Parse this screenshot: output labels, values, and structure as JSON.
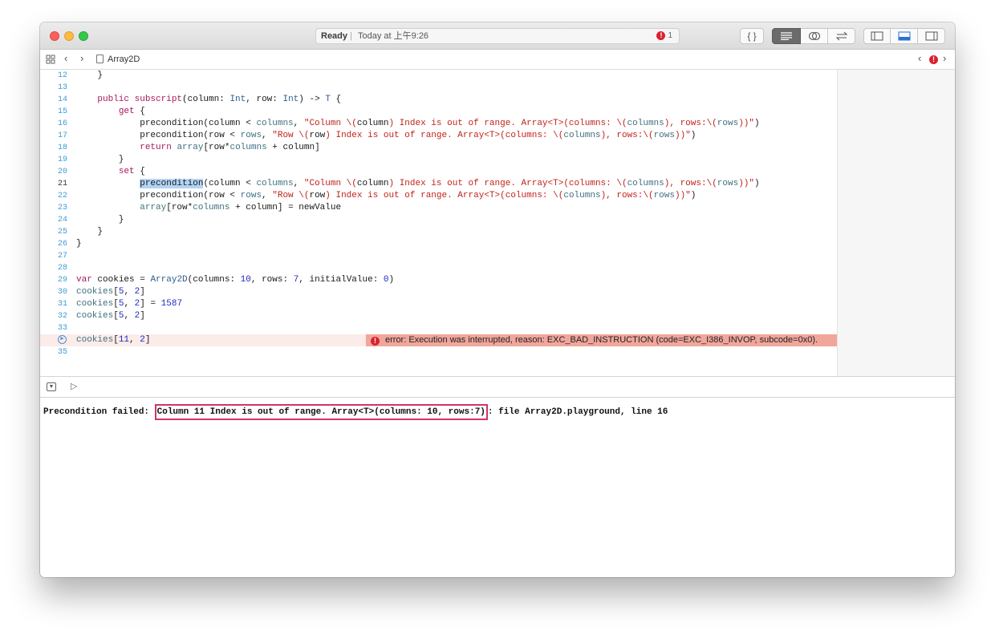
{
  "window": {
    "status": {
      "state": "Ready",
      "separator": "|",
      "time": "Today at 上午9:26",
      "error_count": "1"
    },
    "toolbar": {
      "code_braces": "{ }"
    }
  },
  "jumpbar": {
    "file_name": "Array2D",
    "issue_count": "!"
  },
  "editor": {
    "lines": [
      {
        "n": "12",
        "segments": [
          {
            "t": "    }",
            "c": ""
          }
        ]
      },
      {
        "n": "13",
        "segments": []
      },
      {
        "n": "14",
        "segments": [
          {
            "t": "    ",
            "c": ""
          },
          {
            "t": "public subscript",
            "c": "kw"
          },
          {
            "t": "(column: ",
            "c": ""
          },
          {
            "t": "Int",
            "c": "ty"
          },
          {
            "t": ", row: ",
            "c": ""
          },
          {
            "t": "Int",
            "c": "ty"
          },
          {
            "t": ") -> ",
            "c": ""
          },
          {
            "t": "T",
            "c": "ty"
          },
          {
            "t": " {",
            "c": ""
          }
        ]
      },
      {
        "n": "15",
        "segments": [
          {
            "t": "        ",
            "c": ""
          },
          {
            "t": "get",
            "c": "kw"
          },
          {
            "t": " {",
            "c": ""
          }
        ]
      },
      {
        "n": "16",
        "segments": [
          {
            "t": "            precondition(column < ",
            "c": ""
          },
          {
            "t": "columns",
            "c": "prop"
          },
          {
            "t": ", ",
            "c": ""
          },
          {
            "t": "\"Column \\(",
            "c": "str"
          },
          {
            "t": "column",
            "c": ""
          },
          {
            "t": ") Index is out of range. Array<T>(columns: \\(",
            "c": "str"
          },
          {
            "t": "columns",
            "c": "prop"
          },
          {
            "t": "), rows:\\(",
            "c": "str"
          },
          {
            "t": "rows",
            "c": "prop"
          },
          {
            "t": "))\"",
            "c": "str"
          },
          {
            "t": ")",
            "c": ""
          }
        ]
      },
      {
        "n": "17",
        "segments": [
          {
            "t": "            precondition(row < ",
            "c": ""
          },
          {
            "t": "rows",
            "c": "prop"
          },
          {
            "t": ", ",
            "c": ""
          },
          {
            "t": "\"Row \\(",
            "c": "str"
          },
          {
            "t": "row",
            "c": ""
          },
          {
            "t": ") Index is out of range. Array<T>(columns: \\(",
            "c": "str"
          },
          {
            "t": "columns",
            "c": "prop"
          },
          {
            "t": "), rows:\\(",
            "c": "str"
          },
          {
            "t": "rows",
            "c": "prop"
          },
          {
            "t": "))\"",
            "c": "str"
          },
          {
            "t": ")",
            "c": ""
          }
        ]
      },
      {
        "n": "18",
        "segments": [
          {
            "t": "            ",
            "c": ""
          },
          {
            "t": "return",
            "c": "kw"
          },
          {
            "t": " ",
            "c": ""
          },
          {
            "t": "array",
            "c": "prop"
          },
          {
            "t": "[row*",
            "c": ""
          },
          {
            "t": "columns",
            "c": "prop"
          },
          {
            "t": " + column]",
            "c": ""
          }
        ]
      },
      {
        "n": "19",
        "segments": [
          {
            "t": "        }",
            "c": ""
          }
        ]
      },
      {
        "n": "20",
        "segments": [
          {
            "t": "        ",
            "c": ""
          },
          {
            "t": "set",
            "c": "kw"
          },
          {
            "t": " {",
            "c": ""
          }
        ]
      },
      {
        "n": "21",
        "current": true,
        "segments": [
          {
            "t": "            ",
            "c": ""
          },
          {
            "t": "precondition",
            "c": "sel"
          },
          {
            "t": "(column < ",
            "c": ""
          },
          {
            "t": "columns",
            "c": "prop"
          },
          {
            "t": ", ",
            "c": ""
          },
          {
            "t": "\"Column \\(",
            "c": "str"
          },
          {
            "t": "column",
            "c": ""
          },
          {
            "t": ") Index is out of range. Array<T>(columns: \\(",
            "c": "str"
          },
          {
            "t": "columns",
            "c": "prop"
          },
          {
            "t": "), rows:\\(",
            "c": "str"
          },
          {
            "t": "rows",
            "c": "prop"
          },
          {
            "t": "))\"",
            "c": "str"
          },
          {
            "t": ")",
            "c": ""
          }
        ]
      },
      {
        "n": "22",
        "segments": [
          {
            "t": "            precondition(row < ",
            "c": ""
          },
          {
            "t": "rows",
            "c": "prop"
          },
          {
            "t": ", ",
            "c": ""
          },
          {
            "t": "\"Row \\(",
            "c": "str"
          },
          {
            "t": "row",
            "c": ""
          },
          {
            "t": ") Index is out of range. Array<T>(columns: \\(",
            "c": "str"
          },
          {
            "t": "columns",
            "c": "prop"
          },
          {
            "t": "), rows:\\(",
            "c": "str"
          },
          {
            "t": "rows",
            "c": "prop"
          },
          {
            "t": "))\"",
            "c": "str"
          },
          {
            "t": ")",
            "c": ""
          }
        ]
      },
      {
        "n": "23",
        "segments": [
          {
            "t": "            ",
            "c": ""
          },
          {
            "t": "array",
            "c": "prop"
          },
          {
            "t": "[row*",
            "c": ""
          },
          {
            "t": "columns",
            "c": "prop"
          },
          {
            "t": " + column] = newValue",
            "c": ""
          }
        ]
      },
      {
        "n": "24",
        "segments": [
          {
            "t": "        }",
            "c": ""
          }
        ]
      },
      {
        "n": "25",
        "segments": [
          {
            "t": "    }",
            "c": ""
          }
        ]
      },
      {
        "n": "26",
        "segments": [
          {
            "t": "}",
            "c": ""
          }
        ]
      },
      {
        "n": "27",
        "segments": []
      },
      {
        "n": "28",
        "segments": []
      },
      {
        "n": "29",
        "segments": [
          {
            "t": "var",
            "c": "kw"
          },
          {
            "t": " cookies = ",
            "c": ""
          },
          {
            "t": "Array2D",
            "c": "ty"
          },
          {
            "t": "(columns: ",
            "c": ""
          },
          {
            "t": "10",
            "c": "num"
          },
          {
            "t": ", rows: ",
            "c": ""
          },
          {
            "t": "7",
            "c": "num"
          },
          {
            "t": ", initialValue: ",
            "c": ""
          },
          {
            "t": "0",
            "c": "num"
          },
          {
            "t": ")",
            "c": ""
          }
        ]
      },
      {
        "n": "30",
        "segments": [
          {
            "t": "cookies",
            "c": "prop"
          },
          {
            "t": "[",
            "c": ""
          },
          {
            "t": "5",
            "c": "num"
          },
          {
            "t": ", ",
            "c": ""
          },
          {
            "t": "2",
            "c": "num"
          },
          {
            "t": "]",
            "c": ""
          }
        ]
      },
      {
        "n": "31",
        "segments": [
          {
            "t": "cookies",
            "c": "prop"
          },
          {
            "t": "[",
            "c": ""
          },
          {
            "t": "5",
            "c": "num"
          },
          {
            "t": ", ",
            "c": ""
          },
          {
            "t": "2",
            "c": "num"
          },
          {
            "t": "] = ",
            "c": ""
          },
          {
            "t": "1587",
            "c": "num"
          }
        ]
      },
      {
        "n": "32",
        "segments": [
          {
            "t": "cookies",
            "c": "prop"
          },
          {
            "t": "[",
            "c": ""
          },
          {
            "t": "5",
            "c": "num"
          },
          {
            "t": ", ",
            "c": ""
          },
          {
            "t": "2",
            "c": "num"
          },
          {
            "t": "]",
            "c": ""
          }
        ]
      },
      {
        "n": "33",
        "segments": []
      },
      {
        "n": "",
        "error": true,
        "segments": [
          {
            "t": "cookies",
            "c": "prop"
          },
          {
            "t": "[",
            "c": ""
          },
          {
            "t": "11",
            "c": "num"
          },
          {
            "t": ", ",
            "c": ""
          },
          {
            "t": "2",
            "c": "num"
          },
          {
            "t": "]",
            "c": ""
          }
        ]
      },
      {
        "n": "35",
        "segments": []
      }
    ],
    "error_message": "error: Execution was interrupted, reason: EXC_BAD_INSTRUCTION (code=EXC_I386_INVOP, subcode=0x0)."
  },
  "console": {
    "prefix": "Precondition failed: ",
    "highlighted": "Column 11 Index is out of range. Array<T>(columns: 10, rows:7)",
    "suffix": ": file Array2D.playground, line 16"
  },
  "colors": {
    "error_red": "#d9232f",
    "highlight_border": "#d0356d",
    "error_line_bg": "#f1a69c"
  }
}
